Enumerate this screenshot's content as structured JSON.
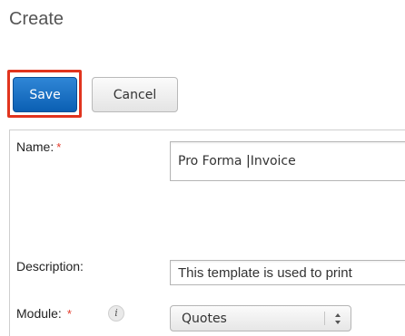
{
  "page": {
    "title": "Create"
  },
  "toolbar": {
    "save_label": "Save",
    "cancel_label": "Cancel"
  },
  "form": {
    "name": {
      "label": "Name:",
      "required_marker": "*",
      "value_before_caret": "Pro Forma ",
      "caret": "|",
      "value_after_caret": "Invoice"
    },
    "description": {
      "label": "Description:",
      "value": "This template is used to print"
    },
    "module": {
      "label": "Module:",
      "required_marker": "*",
      "info_icon": "i",
      "selected": "Quotes"
    }
  },
  "colors": {
    "save_bg": "#1a70c4",
    "highlight": "#e1341e",
    "required": "#e33a2a"
  }
}
